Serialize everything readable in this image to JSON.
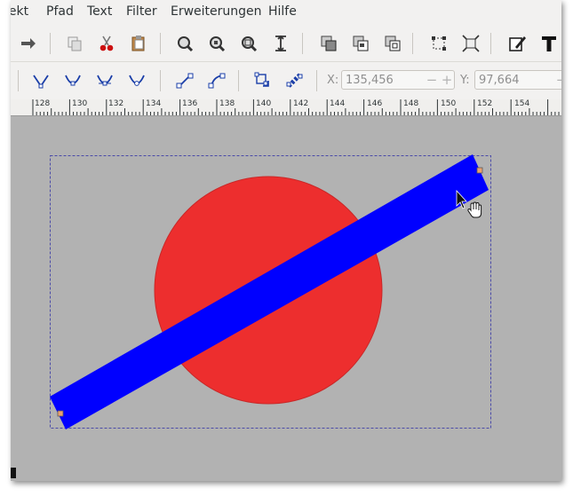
{
  "menubar": {
    "items": [
      "jekt",
      "Pfad",
      "Text",
      "Filter",
      "Erweiterungen",
      "Hilfe"
    ]
  },
  "toolbar1": {
    "icons": [
      "redo-icon",
      "duplicate-icon",
      "cut-icon",
      "paste-icon",
      "zoom-selection-icon",
      "zoom-drawing-icon",
      "zoom-page-icon",
      "zoom-page-width-icon",
      "raise-icon",
      "group-icon",
      "ungroup-icon",
      "fill-stroke-icon",
      "align-icon",
      "text-edit-icon",
      "text-tool-icon"
    ]
  },
  "toolbar2": {
    "icons": [
      "node-cusp-icon",
      "node-smooth-icon",
      "node-symmetric-icon",
      "node-auto-icon",
      "segment-line-icon",
      "segment-curve-icon",
      "object-to-path-icon",
      "stroke-to-path-icon"
    ],
    "x_label": "X:",
    "x_value": "135,456",
    "y_label": "Y:",
    "y_value": "97,664",
    "minus": "−",
    "plus": "+"
  },
  "ruler": {
    "labels": [
      "128",
      "130",
      "132",
      "134",
      "136",
      "138",
      "140",
      "142",
      "144",
      "146",
      "148",
      "150",
      "152",
      "154"
    ]
  },
  "canvas": {
    "background": "#b2b2b2",
    "circle_color": "#ed2e2e",
    "bar_color": "#0000ff",
    "bbox_color": "#4a4aa8",
    "handle_color": "#e8a070"
  }
}
